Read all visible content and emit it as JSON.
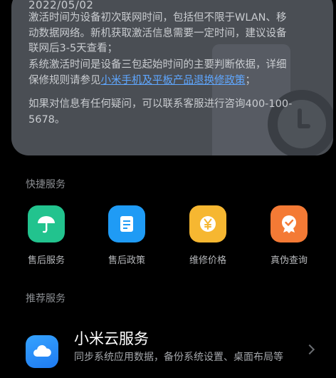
{
  "info_card": {
    "date": "2022/05/02",
    "para1": "激活时间为设备初次联网时间，包括但不限于WLAN、移动数据网络。新机获取激活信息需要一定时间，建议设备联网后3-5天查看；",
    "para2_prefix": "系统激活时间是设备三包起始时间的主要判断依据，详细保修规则请参见",
    "para2_link": "小米手机及平板产品退换修政策",
    "para2_suffix": "；",
    "para3": "如果对信息有任何疑问，可以联系客服进行咨询400-100-5678。"
  },
  "quick_services": {
    "title": "快捷服务",
    "items": [
      {
        "label": "售后服务",
        "icon": "umbrella-icon",
        "color": "#22c38e"
      },
      {
        "label": "售后政策",
        "icon": "document-icon",
        "color": "#1f9bf5"
      },
      {
        "label": "维修价格",
        "icon": "yen-coin-icon",
        "color": "#f6b731"
      },
      {
        "label": "真伪查询",
        "icon": "verified-badge-icon",
        "color": "#f47a35"
      }
    ]
  },
  "recommended": {
    "title": "推荐服务",
    "card": {
      "title": "小米云服务",
      "desc": "同步系统应用数据，备份系统设置、桌面布局等",
      "icon": "cloud-icon"
    }
  }
}
